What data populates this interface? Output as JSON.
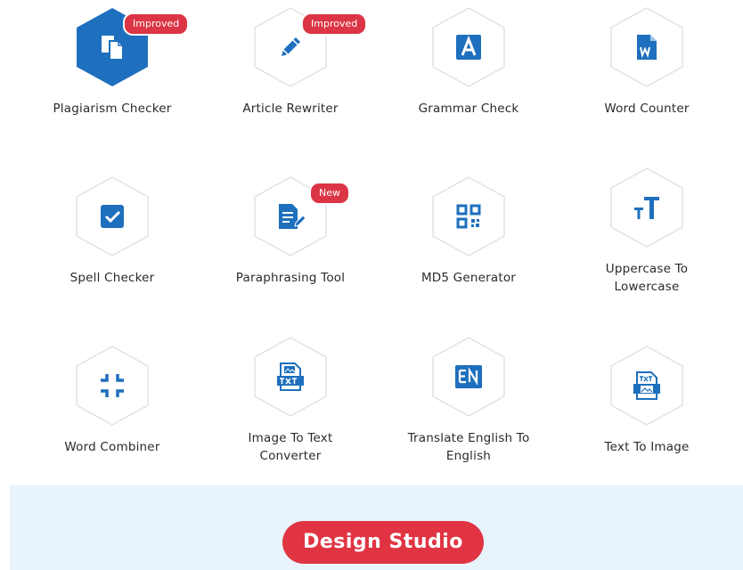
{
  "tools": [
    {
      "label": "Plagiarism Checker",
      "icon": "documents-icon",
      "badge": "Improved"
    },
    {
      "label": "Article Rewriter",
      "icon": "pencil-icon",
      "badge": "Improved"
    },
    {
      "label": "Grammar Check",
      "icon": "letter-a-icon"
    },
    {
      "label": "Word Counter",
      "icon": "word-file-icon"
    },
    {
      "label": "Spell Checker",
      "icon": "checkbox-icon"
    },
    {
      "label": "Paraphrasing Tool",
      "icon": "document-edit-icon",
      "badge": "New"
    },
    {
      "label": "MD5 Generator",
      "icon": "qr-code-icon"
    },
    {
      "label_line1": "Uppercase To",
      "label_line2": "Lowercase",
      "icon": "text-case-icon"
    },
    {
      "label": "Word Combiner",
      "icon": "compress-icon"
    },
    {
      "label_line1": "Image To Text",
      "label_line2": "Converter",
      "icon": "image-txt-icon"
    },
    {
      "label_line1": "Translate English To",
      "label_line2": "English",
      "icon": "en-language-icon"
    },
    {
      "label": "Text To Image",
      "icon": "txt-image-icon"
    }
  ],
  "footer": {
    "button_label": "Design Studio"
  },
  "colors": {
    "brand_blue": "#1e6fbd",
    "badge_red": "#dc3545",
    "button_red": "#e03443",
    "footer_bg": "#e8f3fc"
  }
}
